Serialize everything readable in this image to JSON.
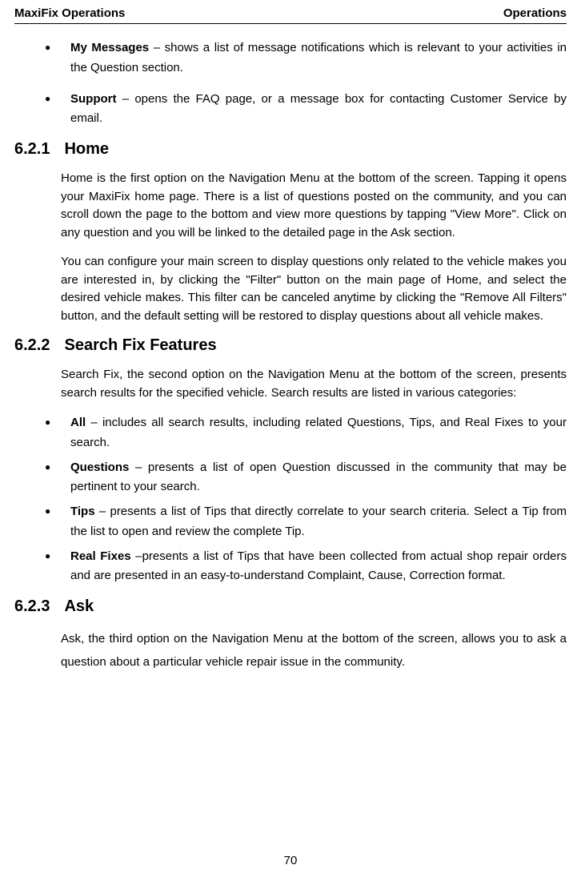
{
  "header": {
    "left": "MaxiFix Operations",
    "right": "Operations"
  },
  "top_bullets": [
    {
      "term": "My Messages",
      "text": " – shows a list of message notifications which is relevant to your activities in the Question section."
    },
    {
      "term": "Support",
      "text": " – opens the FAQ page, or a message box for contacting Customer Service by email."
    }
  ],
  "sections": {
    "home": {
      "num": "6.2.1",
      "title": "Home",
      "paras": [
        "Home is the first option on the Navigation Menu at the bottom of the screen. Tapping it opens your MaxiFix home page. There is a list of questions posted on the community, and you can scroll down the page to the bottom and view more questions by tapping \"View More\". Click on any question and you will be linked to the detailed page in the Ask section.",
        "You can configure your main screen to display questions only related to the vehicle makes you are interested in, by clicking the \"Filter\" button on the main page of Home, and select the desired vehicle makes. This filter can be canceled anytime by clicking the \"Remove All Filters\" button, and the default setting will be restored to display questions about all vehicle makes."
      ]
    },
    "search": {
      "num": "6.2.2",
      "title": "Search Fix Features",
      "intro": "Search Fix, the second option on the Navigation Menu at the bottom of the screen, presents search results for the specified vehicle. Search results are listed in various categories:",
      "bullets": [
        {
          "term": "All",
          "text": " – includes all search results, including related Questions, Tips, and Real Fixes to your search."
        },
        {
          "term": "Questions",
          "text": " – presents a list of open Question discussed in the community that may be pertinent to your search."
        },
        {
          "term": "Tips",
          "text": " – presents a list of Tips that directly correlate to your search criteria. Select a Tip from the list to open and review the complete Tip."
        },
        {
          "term": "Real Fixes",
          "text": " –presents a list of Tips that have been collected from actual shop repair orders and are presented in an easy-to-understand Complaint, Cause, Correction format."
        }
      ]
    },
    "ask": {
      "num": "6.2.3",
      "title": "Ask",
      "para": "Ask, the third option on the Navigation Menu at the bottom of the screen, allows you to ask a question about a particular vehicle repair issue in the community."
    }
  },
  "page_number": "70"
}
